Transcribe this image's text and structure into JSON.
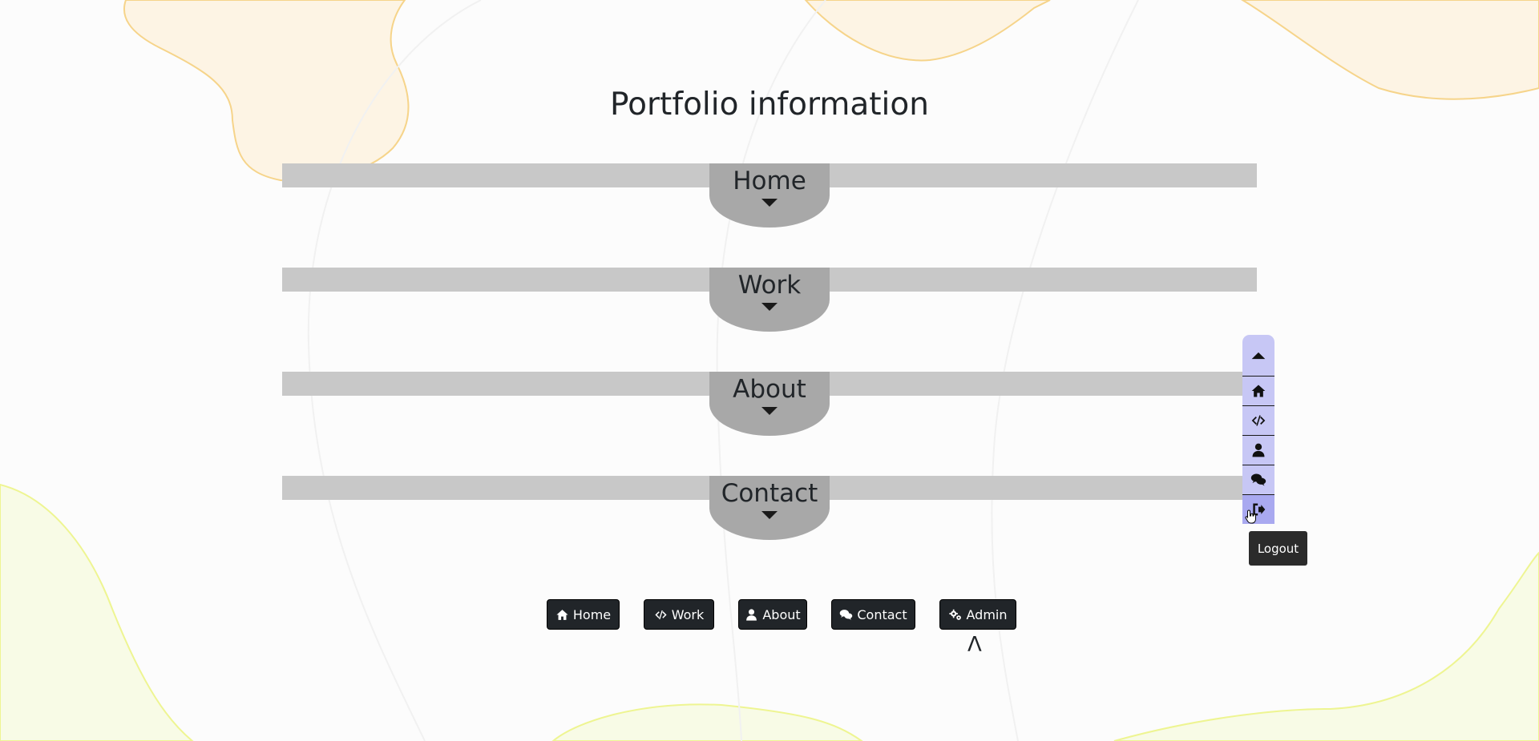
{
  "page": {
    "title": "Portfolio information"
  },
  "sections": [
    {
      "label": "Home"
    },
    {
      "label": "Work"
    },
    {
      "label": "About"
    },
    {
      "label": "Contact"
    }
  ],
  "nav_buttons": [
    {
      "label": "Home",
      "icon": "home-icon"
    },
    {
      "label": "Work",
      "icon": "code-icon"
    },
    {
      "label": "About",
      "icon": "user-icon"
    },
    {
      "label": "Contact",
      "icon": "comments-icon"
    },
    {
      "label": "Admin",
      "icon": "gears-icon"
    }
  ],
  "admin_indicator": "Λ",
  "side_nav": {
    "items": [
      {
        "icon": "caret-up-icon"
      },
      {
        "icon": "home-icon"
      },
      {
        "icon": "code-icon"
      },
      {
        "icon": "user-icon"
      },
      {
        "icon": "comments-icon"
      },
      {
        "icon": "logout-icon"
      }
    ],
    "tooltip": "Logout"
  },
  "colors": {
    "background": "#fcfcfc",
    "section_bar": "#c8c8c8",
    "section_tab": "#a8a8a8",
    "button_bg": "#212529",
    "side_nav_bg": "#c7c7f5",
    "side_nav_active": "#a9a9f0",
    "blob_orange": "#f6d48a",
    "blob_green": "#eef592"
  }
}
